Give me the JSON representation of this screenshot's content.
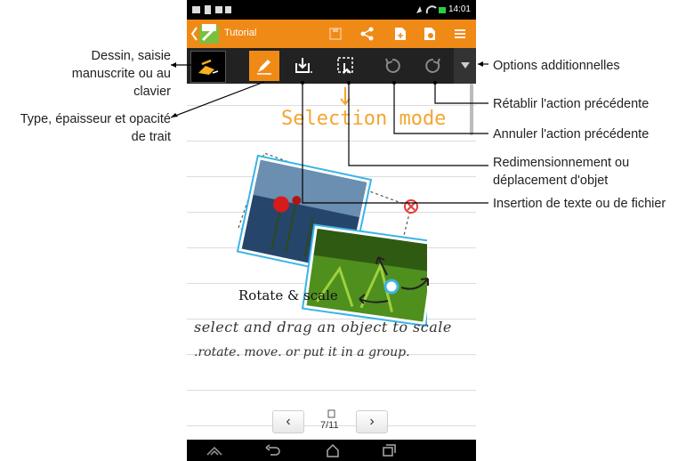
{
  "status": {
    "time": "14:01"
  },
  "app": {
    "title": "Tutorial"
  },
  "canvas": {
    "mode_text": "Selection mode",
    "rotate_label": "Rotate & scale",
    "hand_line1": "select and drag an object to scale",
    "hand_line2": ".rotate. move. or put it in a group."
  },
  "pager": {
    "prev": "‹",
    "next": "›",
    "page": "7/11"
  },
  "callouts_left": {
    "draw_mode": "Dessin, saisie manuscrite ou au clavier",
    "draw_mode_l1": "Dessin, saisie",
    "draw_mode_l2": "manuscrite ou au",
    "draw_mode_l3": "clavier",
    "stroke_l1": "Type, épaisseur et opacité",
    "stroke_l2": "de trait"
  },
  "callouts_right": {
    "more_options": "Options additionnelles",
    "redo": "Rétablir l'action précédente",
    "undo": "Annuler l'action précédente",
    "move_l1": "Redimensionnement ou",
    "move_l2": "déplacement d'objet",
    "insert": "Insertion de texte ou de fichier"
  },
  "colors": {
    "accent": "#f08a17",
    "toolbar": "#222222",
    "selection": "#3bb4e6"
  },
  "icons": [
    "back-chevron-icon",
    "app-icon",
    "save-icon",
    "share-icon",
    "add-page-icon",
    "page-settings-icon",
    "menu-icon",
    "draw-mode-icon",
    "pen-icon",
    "insert-icon",
    "selection-icon",
    "undo-icon",
    "redo-icon",
    "overflow-icon",
    "home-icon",
    "back-icon",
    "recent-apps-icon"
  ]
}
